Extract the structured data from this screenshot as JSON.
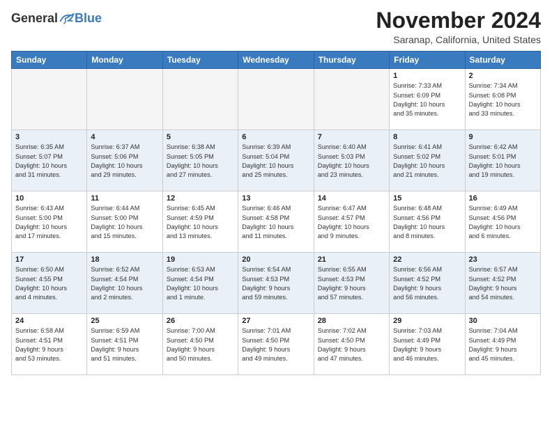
{
  "logo": {
    "general": "General",
    "blue": "Blue"
  },
  "header": {
    "month": "November 2024",
    "location": "Saranap, California, United States"
  },
  "weekdays": [
    "Sunday",
    "Monday",
    "Tuesday",
    "Wednesday",
    "Thursday",
    "Friday",
    "Saturday"
  ],
  "weeks": [
    [
      {
        "day": "",
        "info": ""
      },
      {
        "day": "",
        "info": ""
      },
      {
        "day": "",
        "info": ""
      },
      {
        "day": "",
        "info": ""
      },
      {
        "day": "",
        "info": ""
      },
      {
        "day": "1",
        "info": "Sunrise: 7:33 AM\nSunset: 6:09 PM\nDaylight: 10 hours\nand 35 minutes."
      },
      {
        "day": "2",
        "info": "Sunrise: 7:34 AM\nSunset: 6:08 PM\nDaylight: 10 hours\nand 33 minutes."
      }
    ],
    [
      {
        "day": "3",
        "info": "Sunrise: 6:35 AM\nSunset: 5:07 PM\nDaylight: 10 hours\nand 31 minutes."
      },
      {
        "day": "4",
        "info": "Sunrise: 6:37 AM\nSunset: 5:06 PM\nDaylight: 10 hours\nand 29 minutes."
      },
      {
        "day": "5",
        "info": "Sunrise: 6:38 AM\nSunset: 5:05 PM\nDaylight: 10 hours\nand 27 minutes."
      },
      {
        "day": "6",
        "info": "Sunrise: 6:39 AM\nSunset: 5:04 PM\nDaylight: 10 hours\nand 25 minutes."
      },
      {
        "day": "7",
        "info": "Sunrise: 6:40 AM\nSunset: 5:03 PM\nDaylight: 10 hours\nand 23 minutes."
      },
      {
        "day": "8",
        "info": "Sunrise: 6:41 AM\nSunset: 5:02 PM\nDaylight: 10 hours\nand 21 minutes."
      },
      {
        "day": "9",
        "info": "Sunrise: 6:42 AM\nSunset: 5:01 PM\nDaylight: 10 hours\nand 19 minutes."
      }
    ],
    [
      {
        "day": "10",
        "info": "Sunrise: 6:43 AM\nSunset: 5:00 PM\nDaylight: 10 hours\nand 17 minutes."
      },
      {
        "day": "11",
        "info": "Sunrise: 6:44 AM\nSunset: 5:00 PM\nDaylight: 10 hours\nand 15 minutes."
      },
      {
        "day": "12",
        "info": "Sunrise: 6:45 AM\nSunset: 4:59 PM\nDaylight: 10 hours\nand 13 minutes."
      },
      {
        "day": "13",
        "info": "Sunrise: 6:46 AM\nSunset: 4:58 PM\nDaylight: 10 hours\nand 11 minutes."
      },
      {
        "day": "14",
        "info": "Sunrise: 6:47 AM\nSunset: 4:57 PM\nDaylight: 10 hours\nand 9 minutes."
      },
      {
        "day": "15",
        "info": "Sunrise: 6:48 AM\nSunset: 4:56 PM\nDaylight: 10 hours\nand 8 minutes."
      },
      {
        "day": "16",
        "info": "Sunrise: 6:49 AM\nSunset: 4:56 PM\nDaylight: 10 hours\nand 6 minutes."
      }
    ],
    [
      {
        "day": "17",
        "info": "Sunrise: 6:50 AM\nSunset: 4:55 PM\nDaylight: 10 hours\nand 4 minutes."
      },
      {
        "day": "18",
        "info": "Sunrise: 6:52 AM\nSunset: 4:54 PM\nDaylight: 10 hours\nand 2 minutes."
      },
      {
        "day": "19",
        "info": "Sunrise: 6:53 AM\nSunset: 4:54 PM\nDaylight: 10 hours\nand 1 minute."
      },
      {
        "day": "20",
        "info": "Sunrise: 6:54 AM\nSunset: 4:53 PM\nDaylight: 9 hours\nand 59 minutes."
      },
      {
        "day": "21",
        "info": "Sunrise: 6:55 AM\nSunset: 4:53 PM\nDaylight: 9 hours\nand 57 minutes."
      },
      {
        "day": "22",
        "info": "Sunrise: 6:56 AM\nSunset: 4:52 PM\nDaylight: 9 hours\nand 56 minutes."
      },
      {
        "day": "23",
        "info": "Sunrise: 6:57 AM\nSunset: 4:52 PM\nDaylight: 9 hours\nand 54 minutes."
      }
    ],
    [
      {
        "day": "24",
        "info": "Sunrise: 6:58 AM\nSunset: 4:51 PM\nDaylight: 9 hours\nand 53 minutes."
      },
      {
        "day": "25",
        "info": "Sunrise: 6:59 AM\nSunset: 4:51 PM\nDaylight: 9 hours\nand 51 minutes."
      },
      {
        "day": "26",
        "info": "Sunrise: 7:00 AM\nSunset: 4:50 PM\nDaylight: 9 hours\nand 50 minutes."
      },
      {
        "day": "27",
        "info": "Sunrise: 7:01 AM\nSunset: 4:50 PM\nDaylight: 9 hours\nand 49 minutes."
      },
      {
        "day": "28",
        "info": "Sunrise: 7:02 AM\nSunset: 4:50 PM\nDaylight: 9 hours\nand 47 minutes."
      },
      {
        "day": "29",
        "info": "Sunrise: 7:03 AM\nSunset: 4:49 PM\nDaylight: 9 hours\nand 46 minutes."
      },
      {
        "day": "30",
        "info": "Sunrise: 7:04 AM\nSunset: 4:49 PM\nDaylight: 9 hours\nand 45 minutes."
      }
    ]
  ]
}
